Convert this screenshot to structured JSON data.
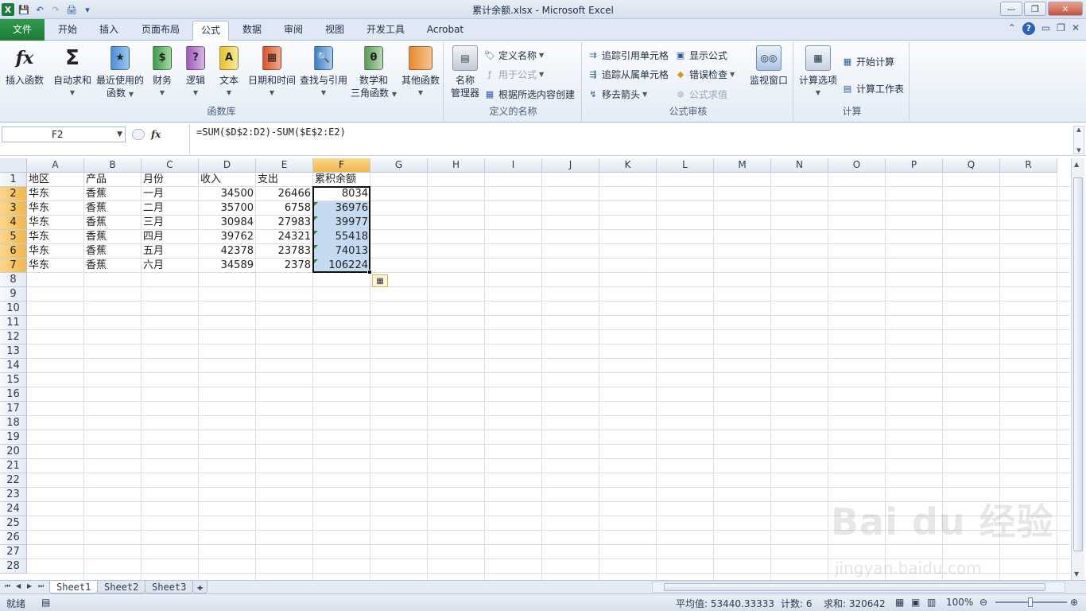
{
  "window": {
    "title": "累计余额.xlsx - Microsoft Excel",
    "buttons": {
      "minimize": "—",
      "restore": "❐",
      "close": "✕"
    }
  },
  "tabs": [
    "文件",
    "开始",
    "插入",
    "页面布局",
    "公式",
    "数据",
    "审阅",
    "视图",
    "开发工具",
    "Acrobat"
  ],
  "active_tab": "公式",
  "ribbon": {
    "function_library": {
      "label": "函数库",
      "insert_function": "插入函数",
      "autosum": "自动求和",
      "recent_1": "最近使用的",
      "recent_2": "函数",
      "financial": "财务",
      "logical": "逻辑",
      "text": "文本",
      "datetime": "日期和时间",
      "lookup": "查找与引用",
      "math_1": "数学和",
      "math_2": "三角函数",
      "other": "其他函数"
    },
    "defined_names": {
      "label": "定义的名称",
      "manager_1": "名称",
      "manager_2": "管理器",
      "define": "定义名称",
      "use_in_formula": "用于公式",
      "create_from_selection": "根据所选内容创建"
    },
    "formula_auditing": {
      "label": "公式审核",
      "trace_precedents": "追踪引用单元格",
      "trace_dependents": "追踪从属单元格",
      "remove_arrows": "移去箭头",
      "show_formulas": "显示公式",
      "error_checking": "错误检查",
      "evaluate": "公式求值",
      "watch_window": "监视窗口"
    },
    "calculation": {
      "label": "计算",
      "options": "计算选项",
      "calc_now": "开始计算",
      "calc_sheet": "计算工作表"
    }
  },
  "formula_bar": {
    "name_box": "F2",
    "fx": "fx",
    "formula": "=SUM($D$2:D2)-SUM($E$2:E2)"
  },
  "columns": [
    "A",
    "B",
    "C",
    "D",
    "E",
    "F",
    "G",
    "H",
    "I",
    "J",
    "K",
    "L",
    "M",
    "N",
    "O",
    "P",
    "Q",
    "R"
  ],
  "rows": [
    "1",
    "2",
    "3",
    "4",
    "5",
    "6",
    "7",
    "8",
    "9",
    "10",
    "11",
    "12",
    "13",
    "14",
    "15",
    "16",
    "17",
    "18",
    "19",
    "20",
    "21",
    "22",
    "23",
    "24",
    "25",
    "26",
    "27",
    "28"
  ],
  "sheet": {
    "headers": [
      "地区",
      "产品",
      "月份",
      "收入",
      "支出",
      "累积余额"
    ],
    "data": [
      [
        "华东",
        "香蕉",
        "一月",
        "34500",
        "26466",
        "8034"
      ],
      [
        "华东",
        "香蕉",
        "二月",
        "35700",
        "6758",
        "36976"
      ],
      [
        "华东",
        "香蕉",
        "三月",
        "30984",
        "27983",
        "39977"
      ],
      [
        "华东",
        "香蕉",
        "四月",
        "39762",
        "24321",
        "55418"
      ],
      [
        "华东",
        "香蕉",
        "五月",
        "42378",
        "23783",
        "74013"
      ],
      [
        "华东",
        "香蕉",
        "六月",
        "34589",
        "2378",
        "106224"
      ]
    ]
  },
  "sheet_tabs": [
    "Sheet1",
    "Sheet2",
    "Sheet3"
  ],
  "active_sheet": "Sheet1",
  "status": {
    "ready": "就绪",
    "average": "平均值: 53440.33333",
    "count": "计数: 6",
    "sum": "求和: 320642",
    "zoom": "100%"
  },
  "watermark": {
    "logo": "Bai du 经验",
    "url": "jingyan.baidu.com"
  }
}
